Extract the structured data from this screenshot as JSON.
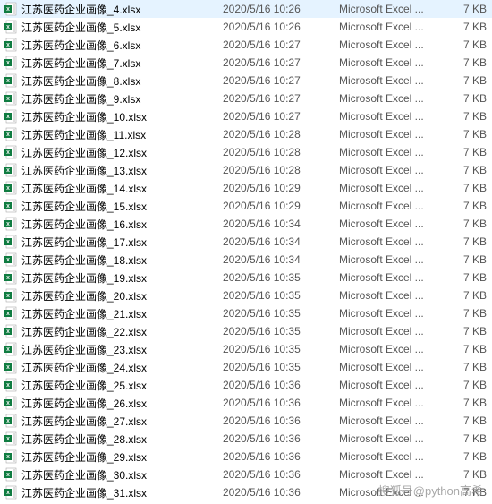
{
  "files": [
    {
      "name": "江苏医药企业画像_4.xlsx",
      "date": "2020/5/16 10:26",
      "type": "Microsoft Excel ...",
      "size": "7 KB"
    },
    {
      "name": "江苏医药企业画像_5.xlsx",
      "date": "2020/5/16 10:26",
      "type": "Microsoft Excel ...",
      "size": "7 KB"
    },
    {
      "name": "江苏医药企业画像_6.xlsx",
      "date": "2020/5/16 10:27",
      "type": "Microsoft Excel ...",
      "size": "7 KB"
    },
    {
      "name": "江苏医药企业画像_7.xlsx",
      "date": "2020/5/16 10:27",
      "type": "Microsoft Excel ...",
      "size": "7 KB"
    },
    {
      "name": "江苏医药企业画像_8.xlsx",
      "date": "2020/5/16 10:27",
      "type": "Microsoft Excel ...",
      "size": "7 KB"
    },
    {
      "name": "江苏医药企业画像_9.xlsx",
      "date": "2020/5/16 10:27",
      "type": "Microsoft Excel ...",
      "size": "7 KB"
    },
    {
      "name": "江苏医药企业画像_10.xlsx",
      "date": "2020/5/16 10:27",
      "type": "Microsoft Excel ...",
      "size": "7 KB"
    },
    {
      "name": "江苏医药企业画像_11.xlsx",
      "date": "2020/5/16 10:28",
      "type": "Microsoft Excel ...",
      "size": "7 KB"
    },
    {
      "name": "江苏医药企业画像_12.xlsx",
      "date": "2020/5/16 10:28",
      "type": "Microsoft Excel ...",
      "size": "7 KB"
    },
    {
      "name": "江苏医药企业画像_13.xlsx",
      "date": "2020/5/16 10:28",
      "type": "Microsoft Excel ...",
      "size": "7 KB"
    },
    {
      "name": "江苏医药企业画像_14.xlsx",
      "date": "2020/5/16 10:29",
      "type": "Microsoft Excel ...",
      "size": "7 KB"
    },
    {
      "name": "江苏医药企业画像_15.xlsx",
      "date": "2020/5/16 10:29",
      "type": "Microsoft Excel ...",
      "size": "7 KB"
    },
    {
      "name": "江苏医药企业画像_16.xlsx",
      "date": "2020/5/16 10:34",
      "type": "Microsoft Excel ...",
      "size": "7 KB"
    },
    {
      "name": "江苏医药企业画像_17.xlsx",
      "date": "2020/5/16 10:34",
      "type": "Microsoft Excel ...",
      "size": "7 KB"
    },
    {
      "name": "江苏医药企业画像_18.xlsx",
      "date": "2020/5/16 10:34",
      "type": "Microsoft Excel ...",
      "size": "7 KB"
    },
    {
      "name": "江苏医药企业画像_19.xlsx",
      "date": "2020/5/16 10:35",
      "type": "Microsoft Excel ...",
      "size": "7 KB"
    },
    {
      "name": "江苏医药企业画像_20.xlsx",
      "date": "2020/5/16 10:35",
      "type": "Microsoft Excel ...",
      "size": "7 KB"
    },
    {
      "name": "江苏医药企业画像_21.xlsx",
      "date": "2020/5/16 10:35",
      "type": "Microsoft Excel ...",
      "size": "7 KB"
    },
    {
      "name": "江苏医药企业画像_22.xlsx",
      "date": "2020/5/16 10:35",
      "type": "Microsoft Excel ...",
      "size": "7 KB"
    },
    {
      "name": "江苏医药企业画像_23.xlsx",
      "date": "2020/5/16 10:35",
      "type": "Microsoft Excel ...",
      "size": "7 KB"
    },
    {
      "name": "江苏医药企业画像_24.xlsx",
      "date": "2020/5/16 10:35",
      "type": "Microsoft Excel ...",
      "size": "7 KB"
    },
    {
      "name": "江苏医药企业画像_25.xlsx",
      "date": "2020/5/16 10:36",
      "type": "Microsoft Excel ...",
      "size": "7 KB"
    },
    {
      "name": "江苏医药企业画像_26.xlsx",
      "date": "2020/5/16 10:36",
      "type": "Microsoft Excel ...",
      "size": "7 KB"
    },
    {
      "name": "江苏医药企业画像_27.xlsx",
      "date": "2020/5/16 10:36",
      "type": "Microsoft Excel ...",
      "size": "7 KB"
    },
    {
      "name": "江苏医药企业画像_28.xlsx",
      "date": "2020/5/16 10:36",
      "type": "Microsoft Excel ...",
      "size": "7 KB"
    },
    {
      "name": "江苏医药企业画像_29.xlsx",
      "date": "2020/5/16 10:36",
      "type": "Microsoft Excel ...",
      "size": "7 KB"
    },
    {
      "name": "江苏医药企业画像_30.xlsx",
      "date": "2020/5/16 10:36",
      "type": "Microsoft Excel ...",
      "size": "7 KB"
    },
    {
      "name": "江苏医药企业画像_31.xlsx",
      "date": "2020/5/16 10:36",
      "type": "Microsoft Excel ...",
      "size": "7 KB"
    }
  ],
  "watermark": "搜狐号@python高希"
}
